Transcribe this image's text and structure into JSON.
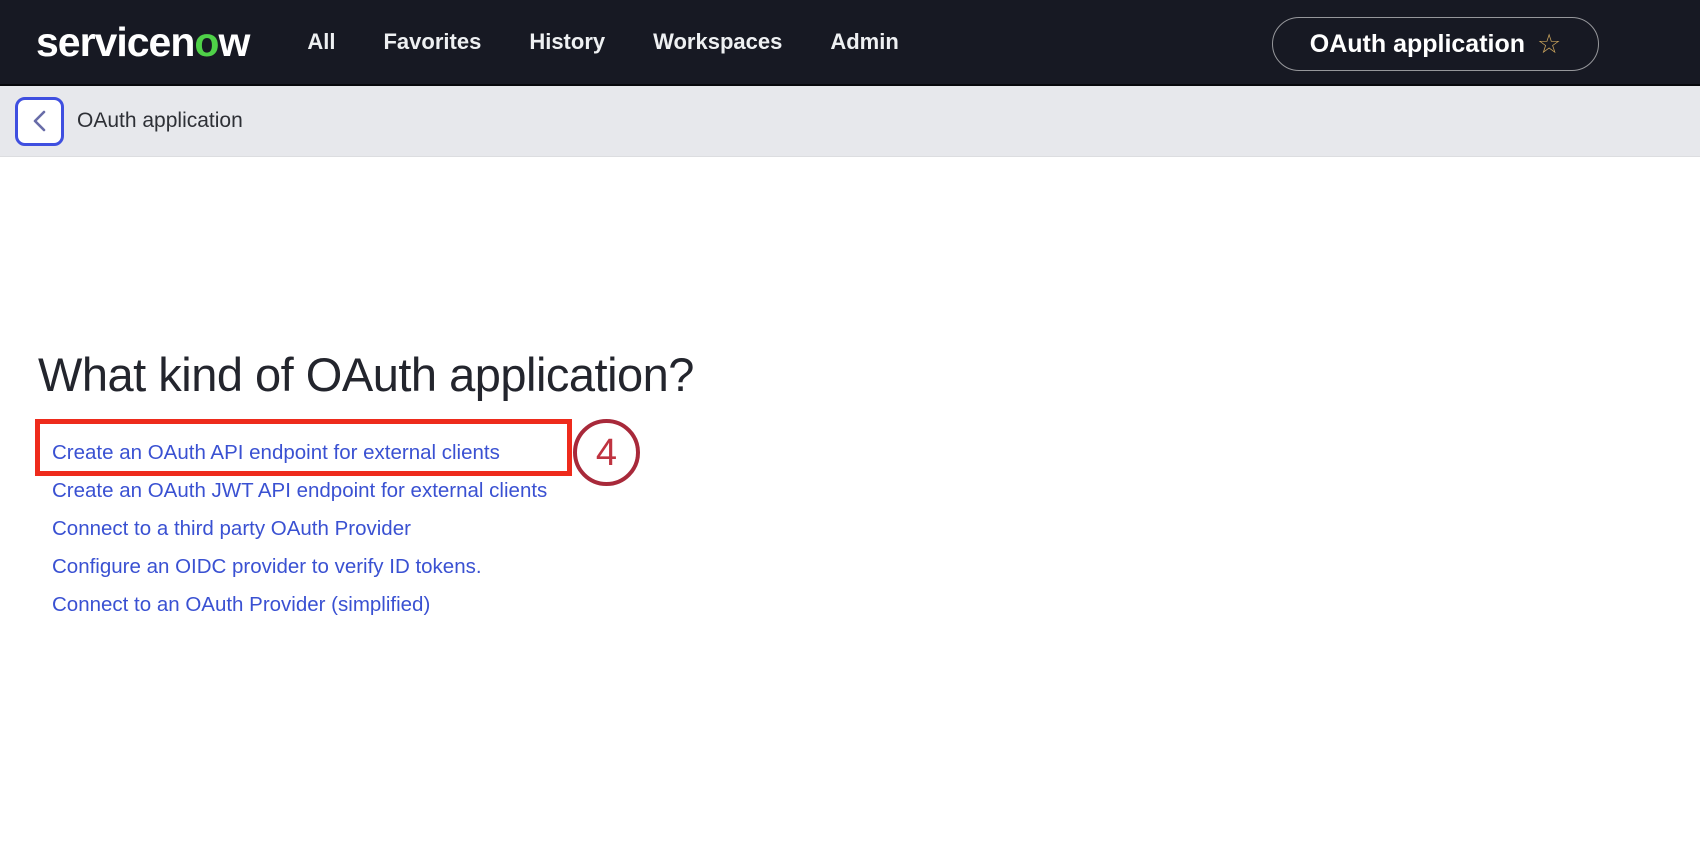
{
  "header": {
    "logo": {
      "prefix": "servicen",
      "accent": "o",
      "suffix": "w"
    },
    "nav_items": [
      "All",
      "Favorites",
      "History",
      "Workspaces",
      "Admin"
    ],
    "favorite_pill": {
      "label": "OAuth application",
      "star_icon": "☆"
    }
  },
  "breadcrumb": {
    "back_icon": "chevron-left",
    "title": "OAuth application"
  },
  "main": {
    "heading": "What kind of OAuth application?",
    "links": [
      "Create an OAuth API endpoint for external clients",
      "Create an OAuth JWT API endpoint for external clients",
      "Connect to a third party OAuth Provider",
      "Configure an OIDC provider to verify ID tokens.",
      "Connect to an OAuth Provider (simplified)"
    ]
  },
  "annotation": {
    "step_number": "4"
  },
  "colors": {
    "nav_background": "#171923",
    "logo_accent_green": "#4fd148",
    "breadcrumb_background": "#e7e8ec",
    "back_button_border_blue": "#3f4fe0",
    "link_blue": "#3a51d2",
    "annotation_box_red": "#ee2b1c",
    "annotation_circle_red": "#a8293a",
    "star_gold": "#c9a35c"
  }
}
